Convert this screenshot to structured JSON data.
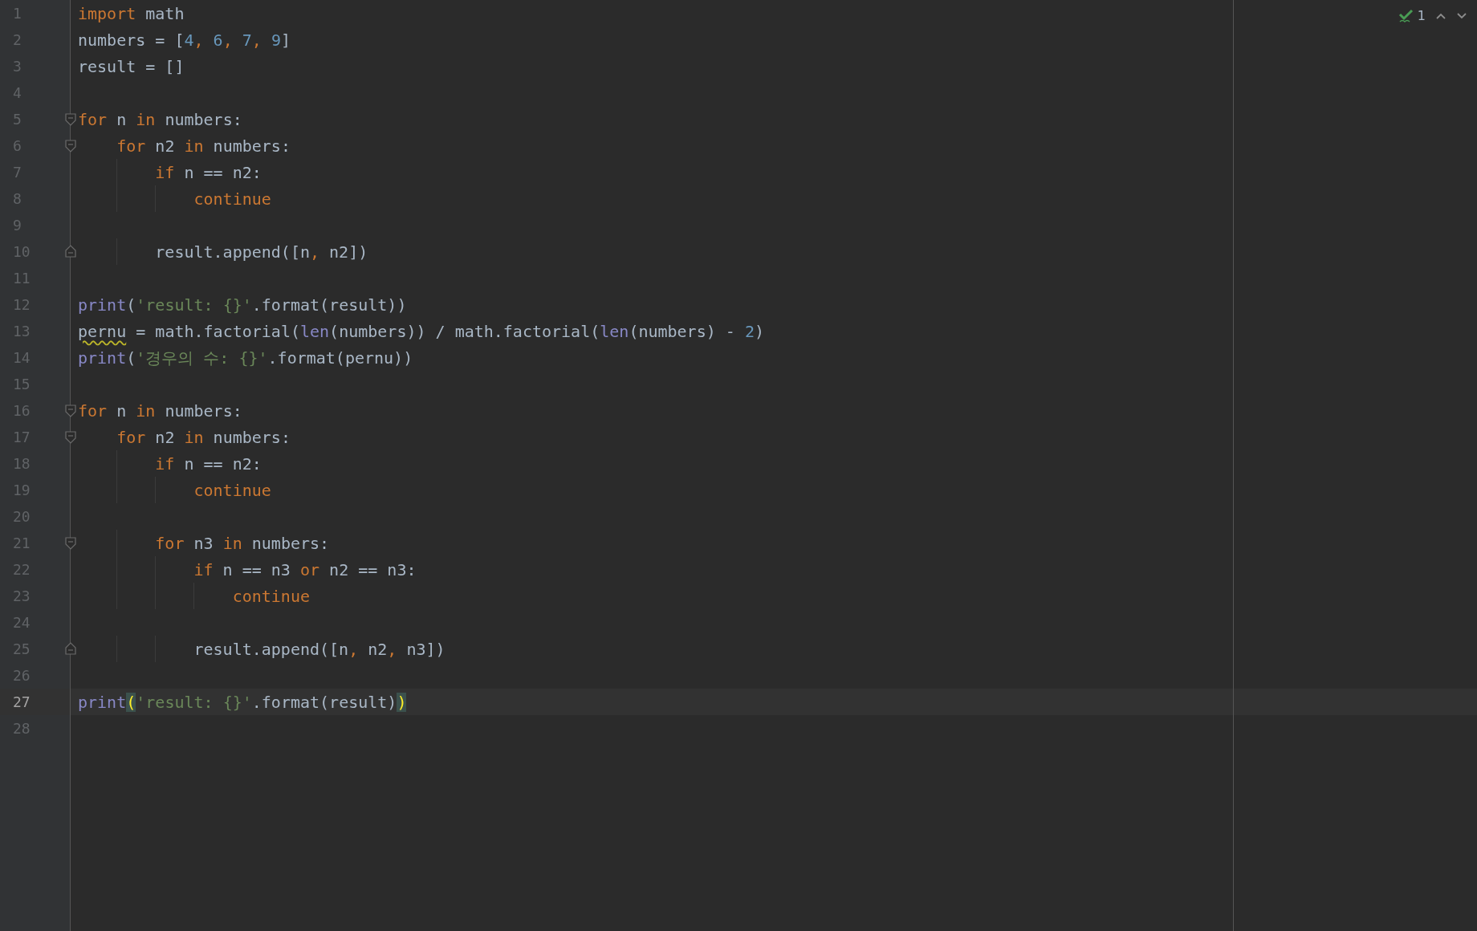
{
  "status": {
    "problems": "1"
  },
  "lines": [
    {
      "number": "1",
      "current": false,
      "kind": "plain",
      "tokens": [
        {
          "kind": "kw",
          "text": "import"
        },
        {
          "kind": "text",
          "text": " math"
        }
      ]
    },
    {
      "number": "2",
      "current": false,
      "kind": "plain",
      "tokens": [
        {
          "kind": "text",
          "text": "numbers = ["
        },
        {
          "kind": "num",
          "text": "4"
        },
        {
          "kind": "kw",
          "text": ", "
        },
        {
          "kind": "num",
          "text": "6"
        },
        {
          "kind": "kw",
          "text": ", "
        },
        {
          "kind": "num",
          "text": "7"
        },
        {
          "kind": "kw",
          "text": ", "
        },
        {
          "kind": "num",
          "text": "9"
        },
        {
          "kind": "text",
          "text": "]"
        }
      ]
    },
    {
      "number": "3",
      "current": false,
      "kind": "plain",
      "tokens": [
        {
          "kind": "text",
          "text": "result = []"
        }
      ]
    },
    {
      "number": "4",
      "current": false,
      "kind": "plain"
    },
    {
      "number": "5",
      "current": false,
      "kind": "fold-start",
      "tokens": [
        {
          "kind": "kw",
          "text": "for"
        },
        {
          "kind": "text",
          "text": " n "
        },
        {
          "kind": "kw",
          "text": "in"
        },
        {
          "kind": "text",
          "text": " numbers:"
        }
      ]
    },
    {
      "number": "6",
      "current": false,
      "kind": "fold-start",
      "tokens": [
        {
          "kind": "kw",
          "text": "    for"
        },
        {
          "kind": "text",
          "text": " n2 "
        },
        {
          "kind": "kw",
          "text": "in"
        },
        {
          "kind": "text",
          "text": " numbers:"
        }
      ]
    },
    {
      "number": "7",
      "current": false,
      "kind": "plain",
      "tokens": [
        {
          "kind": "kw",
          "text": "        if"
        },
        {
          "kind": "text",
          "text": " n == n2:"
        }
      ]
    },
    {
      "number": "8",
      "current": false,
      "kind": "plain",
      "tokens": [
        {
          "kind": "kw",
          "text": "            continue"
        }
      ]
    },
    {
      "number": "9",
      "current": false,
      "kind": "plain"
    },
    {
      "number": "10",
      "current": false,
      "kind": "fold-end",
      "tokens": [
        {
          "kind": "text",
          "text": "        result.append([n"
        },
        {
          "kind": "kw",
          "text": ", "
        },
        {
          "kind": "text",
          "text": "n2])"
        }
      ]
    },
    {
      "number": "11",
      "current": false,
      "kind": "plain"
    },
    {
      "number": "12",
      "current": false,
      "kind": "plain",
      "tokens": [
        {
          "kind": "builtin",
          "text": "print"
        },
        {
          "kind": "text",
          "text": "("
        },
        {
          "kind": "str",
          "text": "'result: {}'"
        },
        {
          "kind": "text",
          "text": ".format(result))"
        }
      ]
    },
    {
      "number": "13",
      "current": false,
      "kind": "plain",
      "tokens": [
        {
          "kind": "warn",
          "text": "pernu"
        },
        {
          "kind": "text",
          "text": " = math.factorial("
        },
        {
          "kind": "builtin",
          "text": "len"
        },
        {
          "kind": "text",
          "text": "(numbers)) / math.factorial("
        },
        {
          "kind": "builtin",
          "text": "len"
        },
        {
          "kind": "text",
          "text": "(numbers) - "
        },
        {
          "kind": "num",
          "text": "2"
        },
        {
          "kind": "text",
          "text": ")"
        }
      ]
    },
    {
      "number": "14",
      "current": false,
      "kind": "plain",
      "tokens": [
        {
          "kind": "builtin",
          "text": "print"
        },
        {
          "kind": "text",
          "text": "("
        },
        {
          "kind": "str",
          "text": "'경우의 수: {}'"
        },
        {
          "kind": "text",
          "text": ".format(pernu))"
        }
      ]
    },
    {
      "number": "15",
      "current": false,
      "kind": "plain"
    },
    {
      "number": "16",
      "current": false,
      "kind": "fold-start",
      "tokens": [
        {
          "kind": "kw",
          "text": "for"
        },
        {
          "kind": "text",
          "text": " n "
        },
        {
          "kind": "kw",
          "text": "in"
        },
        {
          "kind": "text",
          "text": " numbers:"
        }
      ]
    },
    {
      "number": "17",
      "current": false,
      "kind": "fold-start",
      "tokens": [
        {
          "kind": "kw",
          "text": "    for"
        },
        {
          "kind": "text",
          "text": " n2 "
        },
        {
          "kind": "kw",
          "text": "in"
        },
        {
          "kind": "text",
          "text": " numbers:"
        }
      ]
    },
    {
      "number": "18",
      "current": false,
      "kind": "plain",
      "tokens": [
        {
          "kind": "kw",
          "text": "        if"
        },
        {
          "kind": "text",
          "text": " n == n2:"
        }
      ]
    },
    {
      "number": "19",
      "current": false,
      "kind": "plain",
      "tokens": [
        {
          "kind": "kw",
          "text": "            continue"
        }
      ]
    },
    {
      "number": "20",
      "current": false,
      "kind": "plain"
    },
    {
      "number": "21",
      "current": false,
      "kind": "fold-start",
      "tokens": [
        {
          "kind": "kw",
          "text": "        for"
        },
        {
          "kind": "text",
          "text": " n3 "
        },
        {
          "kind": "kw",
          "text": "in"
        },
        {
          "kind": "text",
          "text": " numbers:"
        }
      ]
    },
    {
      "number": "22",
      "current": false,
      "kind": "plain",
      "tokens": [
        {
          "kind": "kw",
          "text": "            if"
        },
        {
          "kind": "text",
          "text": " n == n3 "
        },
        {
          "kind": "kw",
          "text": "or"
        },
        {
          "kind": "text",
          "text": " n2 == n3:"
        }
      ]
    },
    {
      "number": "23",
      "current": false,
      "kind": "plain",
      "tokens": [
        {
          "kind": "kw",
          "text": "                continue"
        }
      ]
    },
    {
      "number": "24",
      "current": false,
      "kind": "plain"
    },
    {
      "number": "25",
      "current": false,
      "kind": "fold-end",
      "tokens": [
        {
          "kind": "text",
          "text": "            result.append([n"
        },
        {
          "kind": "kw",
          "text": ", "
        },
        {
          "kind": "text",
          "text": "n2"
        },
        {
          "kind": "kw",
          "text": ", "
        },
        {
          "kind": "text",
          "text": "n3])"
        }
      ]
    },
    {
      "number": "26",
      "current": false,
      "kind": "plain"
    },
    {
      "number": "27",
      "current": true,
      "kind": "plain",
      "tokens": [
        {
          "kind": "builtin",
          "text": "print"
        },
        {
          "kind": "match",
          "text": "("
        },
        {
          "kind": "str",
          "text": "'result: {}'"
        },
        {
          "kind": "text",
          "text": ".format(result)"
        },
        {
          "kind": "match",
          "text": ")"
        }
      ]
    },
    {
      "number": "28",
      "current": false,
      "kind": "plain"
    }
  ]
}
